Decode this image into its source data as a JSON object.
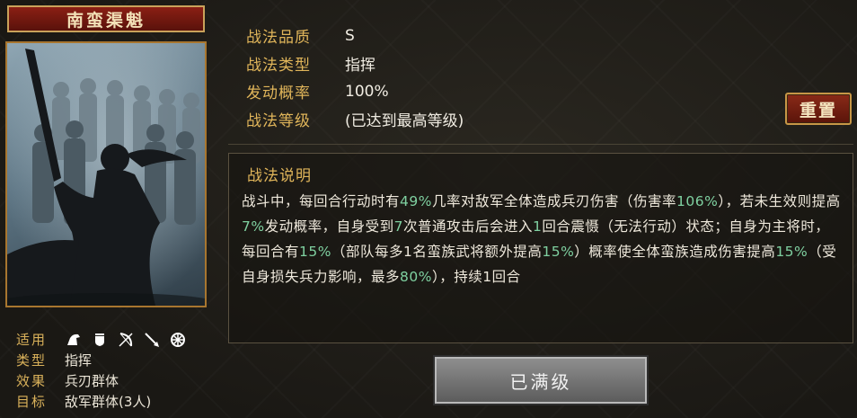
{
  "card": {
    "title": "南蛮渠魁"
  },
  "meta": {
    "applicable_label": "适用",
    "applicable_icons": [
      "cavalry-icon",
      "shield-icon",
      "bow-icon",
      "spear-icon",
      "chariot-icon"
    ],
    "type_label": "类型",
    "type_value": "指挥",
    "effect_label": "效果",
    "effect_value": "兵刃群体",
    "target_label": "目标",
    "target_value": "敌军群体(3人)"
  },
  "info": {
    "quality_label": "战法品质",
    "quality_value": "S",
    "type_label": "战法类型",
    "type_value": "指挥",
    "chance_label": "发动概率",
    "chance_value": "100%",
    "level_label": "战法等级",
    "level_value": "(已达到最高等级)"
  },
  "reset_button": "重置",
  "description": {
    "title": "战法说明",
    "segments": [
      {
        "t": "战斗中，每回合行动时有"
      },
      {
        "t": "49%",
        "hl": true
      },
      {
        "t": "几率对敌军全体造成兵刃伤害（伤害率"
      },
      {
        "t": "106%",
        "hl": true
      },
      {
        "t": "），若未生效则提高"
      },
      {
        "t": "7%",
        "hl": true
      },
      {
        "t": "发动概率，自身受到"
      },
      {
        "t": "7",
        "hl": true
      },
      {
        "t": "次普通攻击后会进入"
      },
      {
        "t": "1",
        "hl": true
      },
      {
        "t": "回合震慑（无法行动）状态；自身为主将时，每回合有"
      },
      {
        "t": "15%",
        "hl": true
      },
      {
        "t": "（部队每多1名蛮族武将额外提高"
      },
      {
        "t": "15%",
        "hl": true
      },
      {
        "t": "）概率使全体蛮族造成伤害提高"
      },
      {
        "t": "15%",
        "hl": true
      },
      {
        "t": "（受自身损失兵力影响，最多"
      },
      {
        "t": "80%",
        "hl": true
      },
      {
        "t": "），持续1回合"
      }
    ]
  },
  "maxed_button": "已满级",
  "colors": {
    "accent_gold": "#e0b55a",
    "highlight_green": "#7fd0a0",
    "title_red": "#8a1f14"
  }
}
